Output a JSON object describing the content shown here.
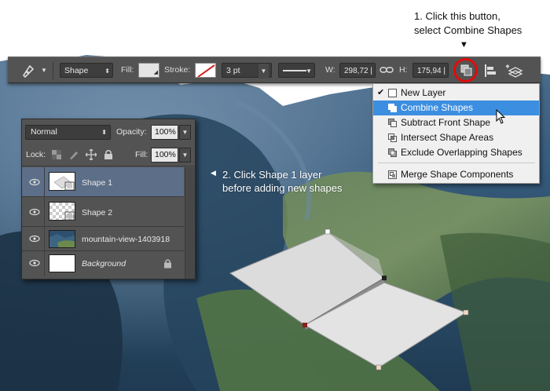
{
  "instructions": {
    "step1_line1": "1. Click this button,",
    "step1_line2": "select Combine Shapes",
    "step2_line1": "2. Click Shape 1 layer",
    "step2_line2": "before adding new shapes"
  },
  "options_bar": {
    "tool_mode": "Shape",
    "fill_label": "Fill:",
    "stroke_label": "Stroke:",
    "stroke_size": "3 pt",
    "w_label": "W:",
    "w_value": "298,72 |",
    "h_label": "H:",
    "h_value": "175,94 |"
  },
  "path_ops_menu": {
    "items": [
      {
        "label": "New Layer",
        "checked": true,
        "selected": false,
        "icon": "new-layer-icon"
      },
      {
        "label": "Combine Shapes",
        "checked": false,
        "selected": true,
        "icon": "combine-shapes-icon"
      },
      {
        "label": "Subtract Front Shape",
        "checked": false,
        "selected": false,
        "icon": "subtract-front-shape-icon"
      },
      {
        "label": "Intersect Shape Areas",
        "checked": false,
        "selected": false,
        "icon": "intersect-shape-areas-icon"
      },
      {
        "label": "Exclude Overlapping Shapes",
        "checked": false,
        "selected": false,
        "icon": "exclude-overlapping-shapes-icon"
      },
      {
        "label": "Merge Shape Components",
        "checked": false,
        "selected": false,
        "icon": "merge-shape-components-icon"
      }
    ]
  },
  "layers_panel": {
    "blend_mode": "Normal",
    "opacity_label": "Opacity:",
    "opacity_value": "100%",
    "lock_label": "Lock:",
    "fill_label": "Fill:",
    "fill_value": "100%",
    "layers": [
      {
        "name": "Shape 1",
        "active": true,
        "type": "shape",
        "visible": true
      },
      {
        "name": "Shape 2",
        "active": false,
        "type": "shape",
        "visible": true
      },
      {
        "name": "mountain-view-1403918",
        "active": false,
        "type": "photo",
        "visible": true
      },
      {
        "name": "Background",
        "active": false,
        "type": "background",
        "visible": true,
        "locked": true
      }
    ]
  },
  "colors": {
    "highlight_ring": "#e10b0b",
    "menu_selection": "#3c8ee0",
    "active_layer": "#5c6e88"
  }
}
